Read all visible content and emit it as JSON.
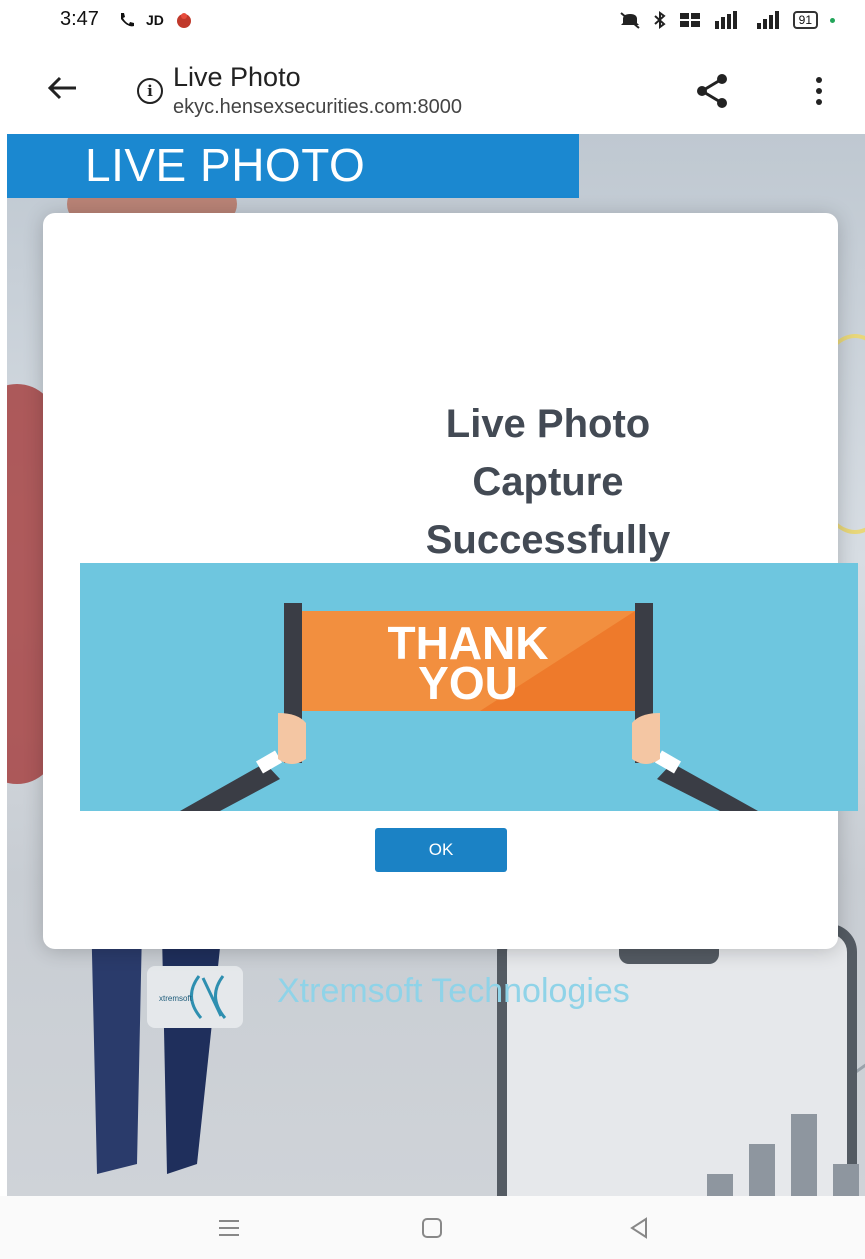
{
  "status_bar": {
    "time": "3:47",
    "left_icons": [
      "phone-call-icon",
      "jd-app-icon",
      "app-notification-icon"
    ],
    "jd_label": "JD",
    "right_icons": [
      "mute-icon",
      "bluetooth-icon",
      "volte-icon",
      "4g-signal-icon",
      "signal-icon",
      "battery-icon"
    ],
    "battery_level": "91"
  },
  "browser": {
    "title": "Live Photo",
    "url": "ekyc.hensexsecurities.com:8000",
    "icons": [
      "back-arrow-icon",
      "info-icon",
      "share-icon",
      "more-vert-icon"
    ]
  },
  "page": {
    "header": "LIVE PHOTO",
    "brand_name": "Xtremsoft Technologies",
    "brand_logo_text": "xtremsoft"
  },
  "modal": {
    "message_line1": "Live Photo",
    "message_line2": "Capture",
    "message_line3": "Successfully",
    "banner_line1": "THANK",
    "banner_line2": "YOU",
    "ok_label": "OK"
  },
  "colors": {
    "accent": "#1b88d0",
    "button": "#1b82c5",
    "banner_bg": "#6ec6df",
    "banner_sign": "#ee7a2b",
    "message_text": "#434a54"
  },
  "nav_bar": {
    "icons": [
      "recent-apps-icon",
      "home-icon",
      "back-icon"
    ]
  }
}
